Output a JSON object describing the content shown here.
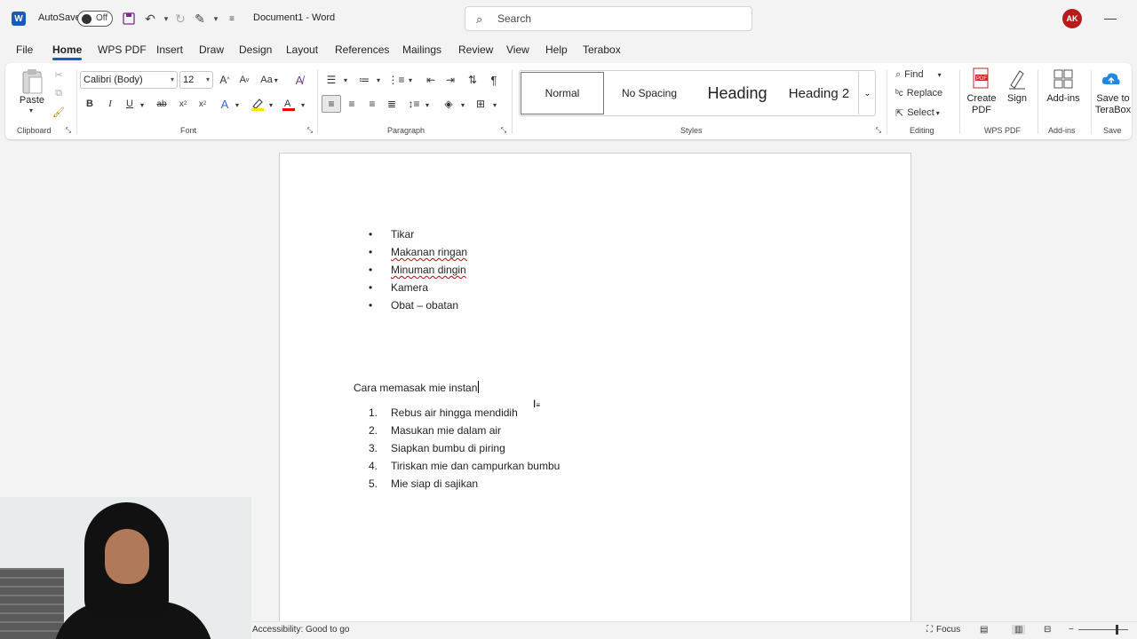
{
  "titlebar": {
    "autosave_label": "AutoSave",
    "autosave_state": "Off",
    "doc_title": "Document1  -  Word",
    "search_placeholder": "Search",
    "user_initials": "AK"
  },
  "menu": {
    "tabs": [
      "File",
      "Home",
      "WPS PDF",
      "Insert",
      "Draw",
      "Design",
      "Layout",
      "References",
      "Mailings",
      "Review",
      "View",
      "Help",
      "Terabox"
    ],
    "active": "Home"
  },
  "ribbon": {
    "clipboard": {
      "paste_label": "Paste",
      "group_label": "Clipboard"
    },
    "font": {
      "font_name": "Calibri (Body)",
      "font_size": "12",
      "group_label": "Font",
      "case_label": "Aa"
    },
    "paragraph": {
      "group_label": "Paragraph"
    },
    "styles": {
      "items": [
        "Normal",
        "No Spacing",
        "Heading",
        "Heading 2"
      ],
      "group_label": "Styles"
    },
    "editing": {
      "find_label": "Find",
      "replace_label": "Replace",
      "select_label": "Select",
      "group_label": "Editing"
    },
    "wps_pdf": {
      "create_label": "Create PDF",
      "sign_label": "Sign",
      "group_label": "WPS PDF"
    },
    "addins": {
      "label": "Add-ins",
      "group_label": "Add-ins"
    },
    "save": {
      "label": "Save to TeraBox",
      "group_label": "Save"
    }
  },
  "document": {
    "bullets": [
      "Tikar",
      "Makanan ringan",
      "Minuman dingin",
      "Kamera",
      "Obat – obatan"
    ],
    "heading": "Cara memasak mie instan",
    "steps": [
      {
        "num": "1.",
        "text": "Rebus air hingga mendidih"
      },
      {
        "num": "2.",
        "text": "Masukan mie dalam air"
      },
      {
        "num": "3.",
        "text": "Siapkan bumbu di piring"
      },
      {
        "num": "4.",
        "text": "Tiriskan mie dan campurkan bumbu"
      },
      {
        "num": "5.",
        "text": "Mie siap di sajikan"
      }
    ]
  },
  "statusbar": {
    "accessibility": "Accessibility: Good to go",
    "focus_label": "Focus"
  },
  "colors": {
    "brand": "#185abd",
    "avatar_bg": "#b71c1c",
    "spell_underline": "#cc0000"
  }
}
